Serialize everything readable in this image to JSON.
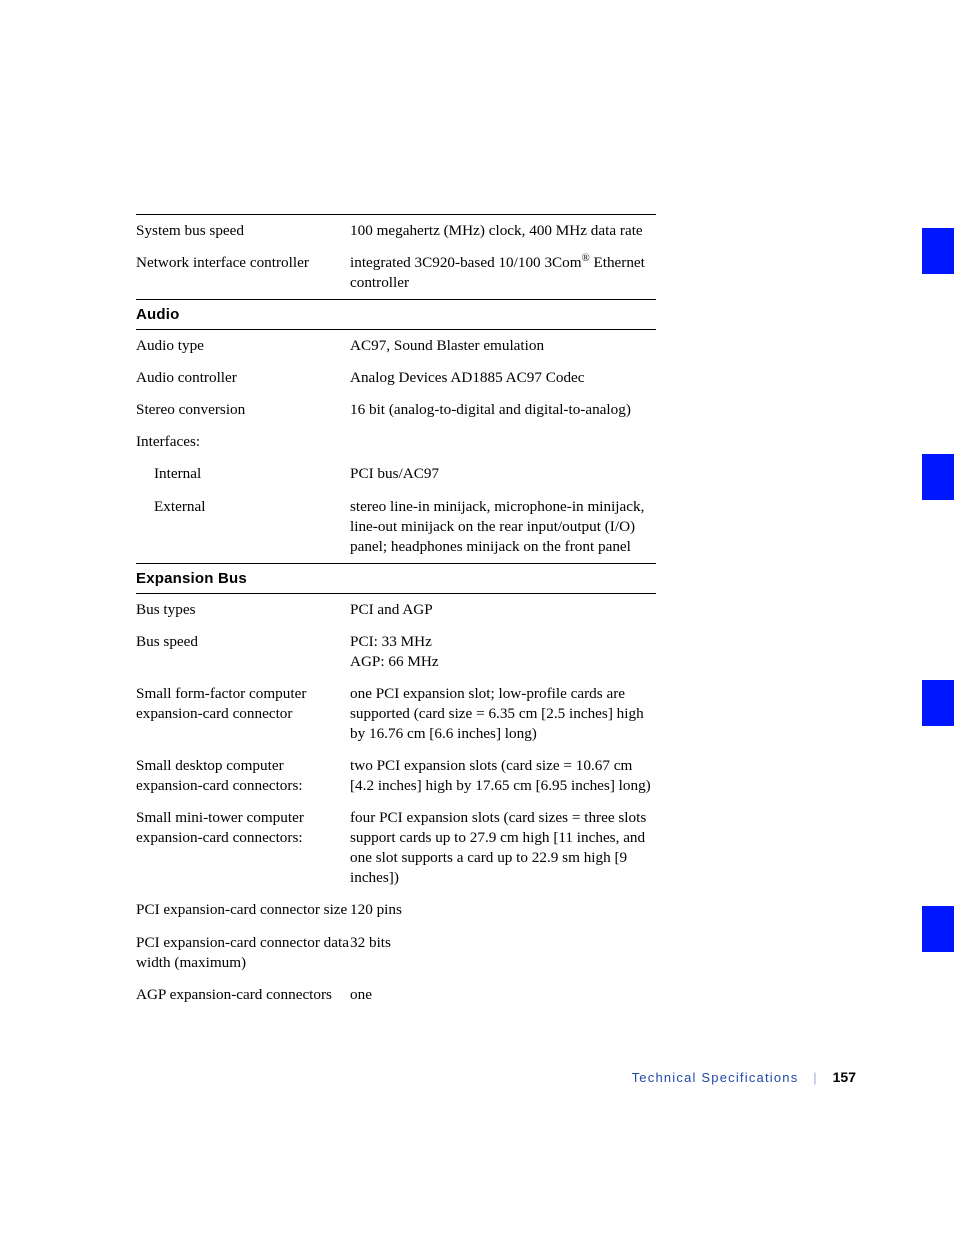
{
  "section1_rows": [
    {
      "label": "System bus speed",
      "value": "100 megahertz (MHz) clock, 400 MHz data rate"
    },
    {
      "label": "Network interface controller",
      "value_html": "integrated 3C920-based 10/100 3Com<sup>®</sup> Ethernet controller"
    }
  ],
  "audio_heading": "Audio",
  "audio_rows": [
    {
      "label": "Audio type",
      "value": "AC97, Sound Blaster emulation"
    },
    {
      "label": "Audio controller",
      "value": "Analog Devices AD1885 AC97 Codec"
    },
    {
      "label": "Stereo conversion",
      "value": "16 bit (analog-to-digital and digital-to-analog)"
    },
    {
      "label": "Interfaces:",
      "value": ""
    },
    {
      "label": "Internal",
      "value": "PCI bus/AC97",
      "indent": true
    },
    {
      "label": "External",
      "value": "stereo line-in minijack, microphone-in minijack, line-out minijack on the rear input/output (I/O) panel; headphones minijack on the front panel",
      "indent": true
    }
  ],
  "expbus_heading": "Expansion Bus",
  "expbus_rows": [
    {
      "label": "Bus types",
      "value": "PCI and AGP"
    },
    {
      "label": "Bus speed",
      "value_html": "PCI: 33 MHz<br>AGP: 66 MHz"
    },
    {
      "label": "Small form-factor computer expansion-card connector",
      "value": "one PCI expansion slot; low-profile cards are supported (card size = 6.35 cm [2.5 inches] high by 16.76 cm [6.6 inches] long)"
    },
    {
      "label": "Small desktop computer expansion-card connectors:",
      "value": "two PCI expansion slots (card size = 10.67 cm [4.2 inches] high by 17.65 cm [6.95 inches] long)"
    },
    {
      "label": "Small mini-tower computer expansion-card connectors:",
      "value": "four PCI expansion slots (card sizes = three slots support cards up to 27.9 cm high [11 inches, and one slot supports a card up to 22.9 sm high [9 inches])"
    },
    {
      "label": "PCI expansion-card connector size",
      "value": "120 pins"
    },
    {
      "label": "PCI expansion-card connector data width (maximum)",
      "value": "32 bits"
    },
    {
      "label": "AGP expansion-card connectors",
      "value": "one"
    }
  ],
  "footer": {
    "title": "Technical Specifications",
    "page": "157"
  }
}
